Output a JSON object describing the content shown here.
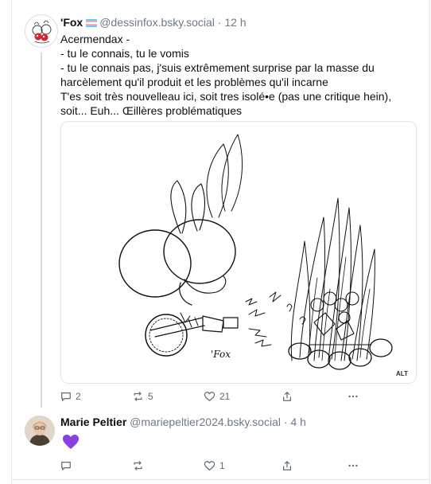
{
  "post1": {
    "author_name": "'Fox",
    "author_handle": "@dessinfox.bsky.social",
    "separator": "·",
    "time": "12 h",
    "text_lines": [
      "Acermendax -",
      "- tu le connais, tu le vomis",
      "- tu le connais pas, j'suis extrêmement surprise par la masse du",
      "harcèlement qu'il produit et les problèmes qu'il incarne",
      "T'es soit très nouvelleau ici, soit tres isolé•e (pas une critique hein),",
      "soit... Euh... Œillères problématiques"
    ],
    "image": {
      "signature": "'Fox",
      "alt_badge": "ALT"
    },
    "actions": {
      "reply_count": "2",
      "repost_count": "5",
      "like_count": "21"
    }
  },
  "post2": {
    "author_name": "Marie Peltier",
    "author_handle": "@mariepeltier2024.bsky.social",
    "separator": "·",
    "time": "4 h",
    "emoji": "purple-heart",
    "actions": {
      "reply_count": "",
      "repost_count": "",
      "like_count": "1"
    }
  },
  "colors": {
    "text": "#0b0f14",
    "muted": "#6f7a86",
    "border": "#e4e8ec",
    "thread_line": "#d4dbe2",
    "heart": "#8a3fe0",
    "trans_flag": [
      "#5bcefa",
      "#f5a9b8",
      "#ffffff",
      "#f5a9b8",
      "#5bcefa"
    ]
  },
  "icons": {
    "reply": "speech-bubble-icon",
    "repost": "repost-arrows-icon",
    "like": "heart-outline-icon",
    "share": "share-upload-icon",
    "more": "ellipsis-icon"
  }
}
